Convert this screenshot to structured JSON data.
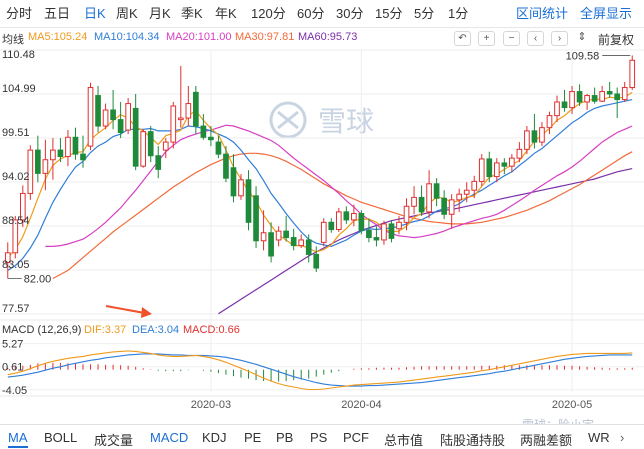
{
  "period_tabs": [
    {
      "label": "分时",
      "active": false
    },
    {
      "label": "五日",
      "active": false
    },
    {
      "label": "日K",
      "active": true
    },
    {
      "label": "周K",
      "active": false
    },
    {
      "label": "月K",
      "active": false
    },
    {
      "label": "季K",
      "active": false
    },
    {
      "label": "年K",
      "active": false
    },
    {
      "label": "120分",
      "active": false
    },
    {
      "label": "60分",
      "active": false
    },
    {
      "label": "30分",
      "active": false
    },
    {
      "label": "15分",
      "active": false
    },
    {
      "label": "5分",
      "active": false
    },
    {
      "label": "1分",
      "active": false
    }
  ],
  "right_actions": {
    "range_stats": "区间统计",
    "fullscreen": "全屏显示"
  },
  "ma_legend": {
    "label": "均线",
    "items": [
      {
        "text": "MA5:105.24",
        "color": "#f09a1a"
      },
      {
        "text": "MA10:104.34",
        "color": "#2f7ed8"
      },
      {
        "text": "MA20:101.00",
        "color": "#d63ec3"
      },
      {
        "text": "MA30:97.81",
        "color": "#f26a3a"
      },
      {
        "text": "MA60:95.73",
        "color": "#7b2ea8"
      }
    ]
  },
  "toolbar_icons": [
    "undo-icon",
    "zoom-in-icon",
    "zoom-out-icon",
    "arrow-left-icon",
    "arrow-right-icon"
  ],
  "adjust_label": "前复权",
  "price_axis_labels": [
    "110.48",
    "104.99",
    "99.51",
    "94.02",
    "88.54",
    "83.05",
    "77.57"
  ],
  "price_annotations": {
    "high": "109.58",
    "low": "82.00"
  },
  "macd_legend": {
    "title": "MACD (12,26,9)",
    "dif": {
      "text": "DIF:3.37",
      "color": "#f09a1a"
    },
    "dea": {
      "text": "DEA:3.04",
      "color": "#2f7ed8"
    },
    "macd": {
      "text": "MACD:0.66",
      "color": "#e03030"
    }
  },
  "macd_axis_labels": [
    "5.27",
    "0.61",
    "-4.05"
  ],
  "date_labels": [
    "2020-03",
    "2020-04",
    "2020-05"
  ],
  "indicator_tabs": [
    {
      "label": "MA",
      "active": true
    },
    {
      "label": "BOLL",
      "active": false
    },
    {
      "label": "成交量",
      "active": false
    },
    {
      "label": "MACD",
      "active": true
    },
    {
      "label": "KDJ",
      "active": false
    },
    {
      "label": "PE",
      "active": false
    },
    {
      "label": "PB",
      "active": false
    },
    {
      "label": "PS",
      "active": false
    },
    {
      "label": "PCF",
      "active": false
    },
    {
      "label": "总市值",
      "active": false
    },
    {
      "label": "陆股通持股",
      "active": false
    },
    {
      "label": "两融差额",
      "active": false
    },
    {
      "label": "WR",
      "active": false
    }
  ],
  "watermark_text": "雪球",
  "watermark_credit": "雪球：险小宇",
  "colors": {
    "up": "#e03030",
    "down": "#1e8a3a",
    "accent": "#1a6fd6"
  },
  "chart_data": {
    "type": "candlestick",
    "candles": [
      {
        "o": 84.0,
        "h": 86.5,
        "l": 82.0,
        "c": 85.2
      },
      {
        "o": 85.2,
        "h": 89.8,
        "l": 84.5,
        "c": 89.3
      },
      {
        "o": 89.3,
        "h": 93.6,
        "l": 88.4,
        "c": 92.6
      },
      {
        "o": 92.6,
        "h": 98.6,
        "l": 91.8,
        "c": 98.0
      },
      {
        "o": 98.0,
        "h": 99.8,
        "l": 94.0,
        "c": 95.1
      },
      {
        "o": 95.1,
        "h": 99.3,
        "l": 93.0,
        "c": 96.8
      },
      {
        "o": 96.8,
        "h": 99.5,
        "l": 94.3,
        "c": 98.0
      },
      {
        "o": 98.0,
        "h": 99.5,
        "l": 96.5,
        "c": 97.2
      },
      {
        "o": 97.2,
        "h": 100.5,
        "l": 96.0,
        "c": 99.6
      },
      {
        "o": 99.6,
        "h": 100.8,
        "l": 96.8,
        "c": 97.5
      },
      {
        "o": 97.5,
        "h": 99.8,
        "l": 95.8,
        "c": 96.8
      },
      {
        "o": 98.5,
        "h": 106.4,
        "l": 98.0,
        "c": 105.8
      },
      {
        "o": 104.8,
        "h": 106.0,
        "l": 100.2,
        "c": 101.0
      },
      {
        "o": 101.0,
        "h": 103.8,
        "l": 100.6,
        "c": 103.0
      },
      {
        "o": 103.0,
        "h": 105.5,
        "l": 100.6,
        "c": 101.8
      },
      {
        "o": 101.8,
        "h": 104.0,
        "l": 99.5,
        "c": 100.2
      },
      {
        "o": 100.5,
        "h": 104.5,
        "l": 100.0,
        "c": 103.8
      },
      {
        "o": 103.2,
        "h": 105.0,
        "l": 95.5,
        "c": 96.0
      },
      {
        "o": 96.0,
        "h": 100.6,
        "l": 95.8,
        "c": 100.3
      },
      {
        "o": 100.3,
        "h": 101.0,
        "l": 96.5,
        "c": 97.3
      },
      {
        "o": 97.3,
        "h": 98.5,
        "l": 94.5,
        "c": 95.6
      },
      {
        "o": 98.0,
        "h": 99.5,
        "l": 97.0,
        "c": 99.0
      },
      {
        "o": 99.0,
        "h": 104.0,
        "l": 98.2,
        "c": 103.5
      },
      {
        "o": 101.8,
        "h": 108.5,
        "l": 100.8,
        "c": 102.0
      },
      {
        "o": 102.0,
        "h": 106.0,
        "l": 101.0,
        "c": 103.8
      },
      {
        "o": 105.2,
        "h": 106.0,
        "l": 100.0,
        "c": 101.0
      },
      {
        "o": 101.0,
        "h": 102.5,
        "l": 99.3,
        "c": 99.6
      },
      {
        "o": 99.6,
        "h": 101.0,
        "l": 98.5,
        "c": 99.3
      },
      {
        "o": 99.0,
        "h": 99.8,
        "l": 97.0,
        "c": 97.5
      },
      {
        "o": 97.5,
        "h": 98.5,
        "l": 94.0,
        "c": 94.5
      },
      {
        "o": 95.8,
        "h": 97.5,
        "l": 91.5,
        "c": 92.3
      },
      {
        "o": 92.3,
        "h": 95.0,
        "l": 91.8,
        "c": 94.3
      },
      {
        "o": 94.3,
        "h": 95.5,
        "l": 88.0,
        "c": 89.0
      },
      {
        "o": 92.3,
        "h": 93.5,
        "l": 85.8,
        "c": 86.7
      },
      {
        "o": 86.7,
        "h": 90.5,
        "l": 85.5,
        "c": 87.7
      },
      {
        "o": 87.7,
        "h": 89.0,
        "l": 84.0,
        "c": 84.8
      },
      {
        "o": 86.8,
        "h": 88.5,
        "l": 86.0,
        "c": 87.9
      },
      {
        "o": 87.9,
        "h": 89.8,
        "l": 86.6,
        "c": 87.1
      },
      {
        "o": 87.1,
        "h": 88.2,
        "l": 85.5,
        "c": 86.1
      },
      {
        "o": 86.1,
        "h": 87.5,
        "l": 85.8,
        "c": 86.8
      },
      {
        "o": 86.8,
        "h": 87.5,
        "l": 84.0,
        "c": 85.0
      },
      {
        "o": 85.0,
        "h": 86.0,
        "l": 82.8,
        "c": 83.3
      },
      {
        "o": 86.5,
        "h": 89.5,
        "l": 86.0,
        "c": 89.0
      },
      {
        "o": 89.0,
        "h": 89.5,
        "l": 87.7,
        "c": 88.1
      },
      {
        "o": 88.1,
        "h": 90.8,
        "l": 87.8,
        "c": 90.3
      },
      {
        "o": 90.3,
        "h": 91.0,
        "l": 88.8,
        "c": 89.3
      },
      {
        "o": 89.3,
        "h": 91.2,
        "l": 88.5,
        "c": 90.1
      },
      {
        "o": 90.1,
        "h": 90.5,
        "l": 87.5,
        "c": 88.0
      },
      {
        "o": 88.0,
        "h": 89.5,
        "l": 86.5,
        "c": 87.1
      },
      {
        "o": 87.1,
        "h": 88.5,
        "l": 86.0,
        "c": 86.8
      },
      {
        "o": 86.8,
        "h": 89.2,
        "l": 86.2,
        "c": 88.8
      },
      {
        "o": 88.8,
        "h": 89.2,
        "l": 86.5,
        "c": 87.0
      },
      {
        "o": 88.2,
        "h": 89.8,
        "l": 87.5,
        "c": 89.0
      },
      {
        "o": 89.0,
        "h": 92.0,
        "l": 88.0,
        "c": 91.0
      },
      {
        "o": 91.0,
        "h": 93.5,
        "l": 90.0,
        "c": 92.1
      },
      {
        "o": 92.1,
        "h": 93.6,
        "l": 89.8,
        "c": 90.3
      },
      {
        "o": 90.3,
        "h": 95.5,
        "l": 89.5,
        "c": 93.8
      },
      {
        "o": 93.8,
        "h": 94.5,
        "l": 91.0,
        "c": 92.0
      },
      {
        "o": 92.0,
        "h": 93.0,
        "l": 89.4,
        "c": 90.0
      },
      {
        "o": 90.0,
        "h": 92.5,
        "l": 88.2,
        "c": 91.8
      },
      {
        "o": 91.8,
        "h": 93.2,
        "l": 90.3,
        "c": 92.5
      },
      {
        "o": 92.5,
        "h": 94.0,
        "l": 91.5,
        "c": 93.0
      },
      {
        "o": 93.0,
        "h": 94.8,
        "l": 92.0,
        "c": 94.1
      },
      {
        "o": 94.1,
        "h": 97.5,
        "l": 93.5,
        "c": 96.9
      },
      {
        "o": 96.9,
        "h": 97.8,
        "l": 94.0,
        "c": 94.7
      },
      {
        "o": 94.7,
        "h": 97.0,
        "l": 94.0,
        "c": 96.4
      },
      {
        "o": 96.4,
        "h": 97.0,
        "l": 95.0,
        "c": 96.0
      },
      {
        "o": 96.0,
        "h": 97.5,
        "l": 95.2,
        "c": 97.0
      },
      {
        "o": 97.0,
        "h": 99.0,
        "l": 96.5,
        "c": 98.1
      },
      {
        "o": 98.1,
        "h": 101.0,
        "l": 97.5,
        "c": 100.4
      },
      {
        "o": 100.4,
        "h": 102.5,
        "l": 98.2,
        "c": 99.0
      },
      {
        "o": 99.0,
        "h": 101.5,
        "l": 98.5,
        "c": 100.8
      },
      {
        "o": 100.8,
        "h": 102.8,
        "l": 100.0,
        "c": 102.3
      },
      {
        "o": 102.3,
        "h": 104.8,
        "l": 101.5,
        "c": 104.0
      },
      {
        "o": 104.0,
        "h": 105.5,
        "l": 102.8,
        "c": 103.3
      },
      {
        "o": 103.3,
        "h": 106.0,
        "l": 102.5,
        "c": 105.3
      },
      {
        "o": 105.3,
        "h": 106.2,
        "l": 103.5,
        "c": 104.0
      },
      {
        "o": 104.0,
        "h": 105.0,
        "l": 103.0,
        "c": 104.8
      },
      {
        "o": 104.8,
        "h": 105.8,
        "l": 103.8,
        "c": 104.1
      },
      {
        "o": 104.1,
        "h": 106.0,
        "l": 104.0,
        "c": 105.3
      },
      {
        "o": 105.3,
        "h": 106.5,
        "l": 104.5,
        "c": 105.0
      },
      {
        "o": 105.0,
        "h": 105.8,
        "l": 102.0,
        "c": 104.3
      },
      {
        "o": 104.3,
        "h": 106.5,
        "l": 104.0,
        "c": 105.8
      },
      {
        "o": 105.8,
        "h": 109.8,
        "l": 105.5,
        "c": 109.2
      }
    ],
    "ma5": [
      84.6,
      85.6,
      87.2,
      89.5,
      92.0,
      94.4,
      96.1,
      96.9,
      97.3,
      97.7,
      97.8,
      99.3,
      100.1,
      100.8,
      101.7,
      102.4,
      102.0,
      100.9,
      100.4,
      99.6,
      98.7,
      99.8,
      100.1,
      100.5,
      102.3,
      102.9,
      101.7,
      100.7,
      99.9,
      98.0,
      95.9,
      94.4,
      92.9,
      91.7,
      89.9,
      88.6,
      87.4,
      86.8,
      86.1,
      86.1,
      85.8,
      85.3,
      85.6,
      86.2,
      87.4,
      88.2,
      89.2,
      89.4,
      89.4,
      89.0,
      88.2,
      87.8,
      87.9,
      88.5,
      89.6,
      90.1,
      91.4,
      92.1,
      92.0,
      91.5,
      91.7,
      92.1,
      92.3,
      93.5,
      94.6,
      95.0,
      95.6,
      96.2,
      96.7,
      97.9,
      99.1,
      99.9,
      100.7,
      101.7,
      102.3,
      103.1,
      103.8,
      104.2,
      104.4,
      104.3,
      104.6,
      104.5,
      104.6,
      105.2
    ],
    "ma10": [
      83.0,
      83.6,
      84.5,
      85.8,
      87.4,
      89.5,
      91.5,
      93.1,
      94.6,
      95.9,
      96.6,
      97.7,
      98.5,
      99.0,
      99.7,
      100.0,
      100.6,
      100.6,
      100.6,
      100.7,
      100.4,
      100.4,
      100.4,
      100.6,
      101.0,
      100.9,
      100.7,
      100.4,
      100.0,
      99.6,
      99.0,
      98.0,
      96.8,
      95.7,
      94.2,
      92.6,
      91.4,
      90.1,
      88.9,
      87.8,
      86.9,
      86.4,
      86.2,
      86.0,
      86.4,
      86.8,
      87.4,
      87.9,
      88.2,
      88.1,
      88.2,
      88.3,
      88.5,
      88.8,
      89.1,
      89.3,
      89.8,
      90.4,
      90.7,
      90.9,
      91.3,
      92.0,
      92.5,
      93.0,
      93.6,
      94.2,
      94.8,
      95.3,
      96.1,
      96.8,
      97.6,
      98.2,
      99.0,
      99.8,
      100.6,
      101.4,
      102.0,
      102.7,
      103.2,
      103.5,
      103.7,
      103.9,
      104.1,
      104.3
    ],
    "ma20": [
      86.0,
      86.0,
      86.1,
      86.3,
      86.6,
      86.9,
      87.5,
      88.2,
      89.0,
      89.9,
      90.8,
      91.9,
      93.0,
      94.2,
      95.4,
      96.6,
      97.8,
      98.6,
      99.3,
      99.7,
      100.0,
      100.3,
      100.5,
      100.8,
      101.1,
      101.0,
      100.7,
      100.4,
      100.0,
      99.6,
      99.2,
      98.6,
      97.8,
      97.0,
      96.3,
      95.6,
      94.9,
      94.2,
      93.4,
      92.6,
      91.7,
      90.9,
      90.0,
      89.3,
      88.7,
      88.0,
      87.6,
      87.3,
      87.2,
      87.1,
      87.2,
      87.4,
      87.6,
      87.9,
      88.3,
      88.6,
      88.9,
      89.2,
      89.5,
      89.7,
      90.0,
      90.5,
      91.1,
      91.7,
      92.3,
      93.0,
      93.6,
      94.2,
      94.8,
      95.3,
      95.9,
      96.6,
      97.4,
      98.2,
      99.0,
      99.6,
      100.2,
      100.6,
      101.0
    ],
    "ma30": [
      82.0,
      82.5,
      83.0,
      83.8,
      84.6,
      85.4,
      86.2,
      87.0,
      87.8,
      88.5,
      89.2,
      89.9,
      90.6,
      91.3,
      92.0,
      92.7,
      93.4,
      94.0,
      94.6,
      95.2,
      95.7,
      96.2,
      96.6,
      97.0,
      97.3,
      97.5,
      97.6,
      97.6,
      97.5,
      97.3,
      97.0,
      96.6,
      96.1,
      95.6,
      95.0,
      94.4,
      93.8,
      93.3,
      92.8,
      92.3,
      91.9,
      91.5,
      91.2,
      90.9,
      90.6,
      90.3,
      90.0,
      89.7,
      89.5,
      89.3,
      89.1,
      89.0,
      88.9,
      88.8,
      88.8,
      88.8,
      88.9,
      89.0,
      89.2,
      89.4,
      89.6,
      89.9,
      90.2,
      90.5,
      90.9,
      91.3,
      91.7,
      92.2,
      92.7,
      93.2,
      93.7,
      94.3,
      94.9,
      95.5,
      96.1,
      96.7,
      97.3,
      97.8
    ],
    "ma60": [
      77.6,
      78.2,
      78.8,
      79.4,
      80.0,
      80.6,
      81.2,
      81.8,
      82.4,
      83.0,
      83.6,
      84.2,
      84.8,
      85.3,
      85.8,
      86.3,
      86.8,
      87.2,
      87.6,
      88.0,
      88.3,
      88.6,
      88.9,
      89.2,
      89.4,
      89.6,
      89.8,
      90.0,
      90.2,
      90.3,
      90.5,
      90.6,
      90.8,
      91.0,
      91.2,
      91.4,
      91.6,
      91.8,
      92.0,
      92.2,
      92.4,
      92.6,
      92.8,
      93.0,
      93.2,
      93.4,
      93.6,
      93.8,
      94.0,
      94.2,
      94.4,
      94.7,
      95.0,
      95.3,
      95.5,
      95.7
    ],
    "dif": [
      -1.0,
      -0.7,
      -0.3,
      0.2,
      0.8,
      1.3,
      1.7,
      2.0,
      2.3,
      2.5,
      2.7,
      3.0,
      3.2,
      3.4,
      3.6,
      3.7,
      3.8,
      3.7,
      3.5,
      3.3,
      3.0,
      2.8,
      2.7,
      2.7,
      2.8,
      2.9,
      2.7,
      2.4,
      2.0,
      1.5,
      0.9,
      0.3,
      -0.3,
      -1.0,
      -1.7,
      -2.3,
      -2.8,
      -3.2,
      -3.5,
      -3.8,
      -4.0,
      -4.0,
      -3.9,
      -3.7,
      -3.5,
      -3.3,
      -3.1,
      -3.0,
      -2.9,
      -2.8,
      -2.7,
      -2.6,
      -2.5,
      -2.3,
      -2.1,
      -1.9,
      -1.7,
      -1.5,
      -1.3,
      -1.1,
      -0.9,
      -0.7,
      -0.5,
      -0.2,
      0.0,
      0.3,
      0.6,
      0.9,
      1.2,
      1.5,
      1.8,
      2.1,
      2.4,
      2.7,
      2.9,
      3.1,
      3.2,
      3.3,
      3.3,
      3.3,
      3.3,
      3.3,
      3.3,
      3.4
    ],
    "dea": [
      -1.5,
      -1.3,
      -1.1,
      -0.8,
      -0.5,
      -0.1,
      0.3,
      0.6,
      1.0,
      1.3,
      1.6,
      1.9,
      2.1,
      2.4,
      2.6,
      2.8,
      3.0,
      3.1,
      3.2,
      3.2,
      3.2,
      3.1,
      3.0,
      3.0,
      2.9,
      2.9,
      2.9,
      2.8,
      2.7,
      2.5,
      2.2,
      1.9,
      1.5,
      1.1,
      0.6,
      0.1,
      -0.4,
      -0.9,
      -1.4,
      -1.8,
      -2.2,
      -2.6,
      -2.9,
      -3.1,
      -3.2,
      -3.3,
      -3.3,
      -3.3,
      -3.2,
      -3.2,
      -3.1,
      -3.0,
      -2.9,
      -2.8,
      -2.7,
      -2.6,
      -2.4,
      -2.2,
      -2.0,
      -1.8,
      -1.6,
      -1.4,
      -1.2,
      -1.0,
      -0.8,
      -0.5,
      -0.3,
      0.0,
      0.3,
      0.6,
      0.9,
      1.2,
      1.5,
      1.8,
      2.1,
      2.3,
      2.5,
      2.7,
      2.8,
      2.9,
      3.0,
      3.0,
      3.0,
      3.0
    ],
    "macd": [
      0.4,
      0.6,
      0.8,
      1.0,
      1.3,
      1.4,
      1.4,
      1.4,
      1.3,
      1.2,
      1.1,
      1.1,
      1.1,
      1.0,
      1.0,
      0.9,
      0.8,
      0.6,
      0.3,
      0.1,
      -0.2,
      -0.3,
      -0.3,
      -0.3,
      -0.1,
      0.0,
      -0.2,
      -0.4,
      -0.7,
      -1.0,
      -1.3,
      -1.6,
      -1.8,
      -2.1,
      -2.3,
      -2.4,
      -2.4,
      -2.3,
      -2.1,
      -2.0,
      -1.8,
      -1.4,
      -1.0,
      -0.6,
      -0.3,
      0.0,
      0.2,
      0.3,
      0.3,
      0.4,
      0.4,
      0.4,
      0.4,
      0.5,
      0.6,
      0.7,
      0.7,
      0.7,
      0.7,
      0.7,
      0.7,
      0.7,
      0.7,
      0.8,
      0.8,
      0.8,
      0.9,
      0.9,
      0.9,
      0.9,
      0.9,
      0.9,
      0.9,
      0.9,
      0.8,
      0.8,
      0.7,
      0.6,
      0.5,
      0.4,
      0.3,
      0.3,
      0.3,
      0.4
    ],
    "price_range": [
      77.57,
      110.48
    ],
    "macd_range": [
      -4.5,
      5.6
    ]
  }
}
